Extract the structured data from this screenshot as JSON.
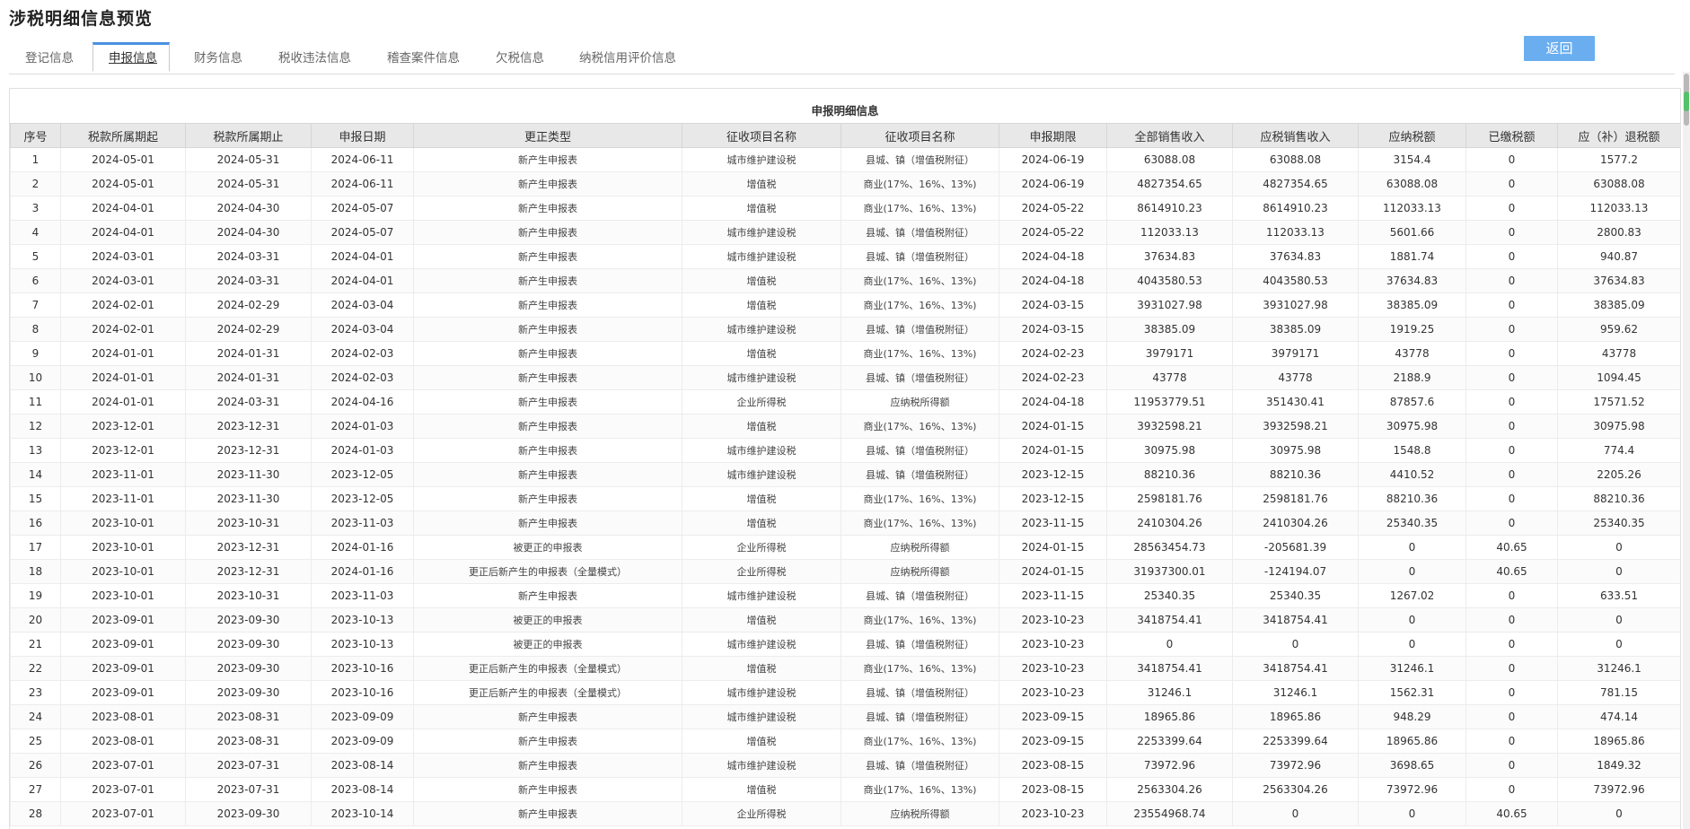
{
  "page_title": "涉税明细信息预览",
  "tabs": [
    {
      "label": "登记信息",
      "active": false
    },
    {
      "label": "申报信息",
      "active": true
    },
    {
      "label": "财务信息",
      "active": false
    },
    {
      "label": "税收违法信息",
      "active": false
    },
    {
      "label": "稽查案件信息",
      "active": false
    },
    {
      "label": "欠税信息",
      "active": false
    },
    {
      "label": "纳税信用评价信息",
      "active": false
    }
  ],
  "back_label": "返回",
  "table": {
    "caption": "申报明细信息",
    "columns": [
      "序号",
      "税款所属期起",
      "税款所属期止",
      "申报日期",
      "更正类型",
      "征收项目名称",
      "征收项目名称",
      "申报期限",
      "全部销售收入",
      "应税销售收入",
      "应纳税额",
      "已缴税额",
      "应（补）退税额"
    ],
    "rows": [
      [
        "1",
        "2024-05-01",
        "2024-05-31",
        "2024-06-11",
        "新产生申报表",
        "城市维护建设税",
        "县城、镇（增值税附征）",
        "2024-06-19",
        "63088.08",
        "63088.08",
        "3154.4",
        "0",
        "1577.2"
      ],
      [
        "2",
        "2024-05-01",
        "2024-05-31",
        "2024-06-11",
        "新产生申报表",
        "增值税",
        "商业(17%、16%、13%)",
        "2024-06-19",
        "4827354.65",
        "4827354.65",
        "63088.08",
        "0",
        "63088.08"
      ],
      [
        "3",
        "2024-04-01",
        "2024-04-30",
        "2024-05-07",
        "新产生申报表",
        "增值税",
        "商业(17%、16%、13%)",
        "2024-05-22",
        "8614910.23",
        "8614910.23",
        "112033.13",
        "0",
        "112033.13"
      ],
      [
        "4",
        "2024-04-01",
        "2024-04-30",
        "2024-05-07",
        "新产生申报表",
        "城市维护建设税",
        "县城、镇（增值税附征）",
        "2024-05-22",
        "112033.13",
        "112033.13",
        "5601.66",
        "0",
        "2800.83"
      ],
      [
        "5",
        "2024-03-01",
        "2024-03-31",
        "2024-04-01",
        "新产生申报表",
        "城市维护建设税",
        "县城、镇（增值税附征）",
        "2024-04-18",
        "37634.83",
        "37634.83",
        "1881.74",
        "0",
        "940.87"
      ],
      [
        "6",
        "2024-03-01",
        "2024-03-31",
        "2024-04-01",
        "新产生申报表",
        "增值税",
        "商业(17%、16%、13%)",
        "2024-04-18",
        "4043580.53",
        "4043580.53",
        "37634.83",
        "0",
        "37634.83"
      ],
      [
        "7",
        "2024-02-01",
        "2024-02-29",
        "2024-03-04",
        "新产生申报表",
        "增值税",
        "商业(17%、16%、13%)",
        "2024-03-15",
        "3931027.98",
        "3931027.98",
        "38385.09",
        "0",
        "38385.09"
      ],
      [
        "8",
        "2024-02-01",
        "2024-02-29",
        "2024-03-04",
        "新产生申报表",
        "城市维护建设税",
        "县城、镇（增值税附征）",
        "2024-03-15",
        "38385.09",
        "38385.09",
        "1919.25",
        "0",
        "959.62"
      ],
      [
        "9",
        "2024-01-01",
        "2024-01-31",
        "2024-02-03",
        "新产生申报表",
        "增值税",
        "商业(17%、16%、13%)",
        "2024-02-23",
        "3979171",
        "3979171",
        "43778",
        "0",
        "43778"
      ],
      [
        "10",
        "2024-01-01",
        "2024-01-31",
        "2024-02-03",
        "新产生申报表",
        "城市维护建设税",
        "县城、镇（增值税附征）",
        "2024-02-23",
        "43778",
        "43778",
        "2188.9",
        "0",
        "1094.45"
      ],
      [
        "11",
        "2024-01-01",
        "2024-03-31",
        "2024-04-16",
        "新产生申报表",
        "企业所得税",
        "应纳税所得额",
        "2024-04-18",
        "11953779.51",
        "351430.41",
        "87857.6",
        "0",
        "17571.52"
      ],
      [
        "12",
        "2023-12-01",
        "2023-12-31",
        "2024-01-03",
        "新产生申报表",
        "增值税",
        "商业(17%、16%、13%)",
        "2024-01-15",
        "3932598.21",
        "3932598.21",
        "30975.98",
        "0",
        "30975.98"
      ],
      [
        "13",
        "2023-12-01",
        "2023-12-31",
        "2024-01-03",
        "新产生申报表",
        "城市维护建设税",
        "县城、镇（增值税附征）",
        "2024-01-15",
        "30975.98",
        "30975.98",
        "1548.8",
        "0",
        "774.4"
      ],
      [
        "14",
        "2023-11-01",
        "2023-11-30",
        "2023-12-05",
        "新产生申报表",
        "城市维护建设税",
        "县城、镇（增值税附征）",
        "2023-12-15",
        "88210.36",
        "88210.36",
        "4410.52",
        "0",
        "2205.26"
      ],
      [
        "15",
        "2023-11-01",
        "2023-11-30",
        "2023-12-05",
        "新产生申报表",
        "增值税",
        "商业(17%、16%、13%)",
        "2023-12-15",
        "2598181.76",
        "2598181.76",
        "88210.36",
        "0",
        "88210.36"
      ],
      [
        "16",
        "2023-10-01",
        "2023-10-31",
        "2023-11-03",
        "新产生申报表",
        "增值税",
        "商业(17%、16%、13%)",
        "2023-11-15",
        "2410304.26",
        "2410304.26",
        "25340.35",
        "0",
        "25340.35"
      ],
      [
        "17",
        "2023-10-01",
        "2023-12-31",
        "2024-01-16",
        "被更正的申报表",
        "企业所得税",
        "应纳税所得额",
        "2024-01-15",
        "28563454.73",
        "-205681.39",
        "0",
        "40.65",
        "0"
      ],
      [
        "18",
        "2023-10-01",
        "2023-12-31",
        "2024-01-16",
        "更正后新产生的申报表（全量模式）",
        "企业所得税",
        "应纳税所得额",
        "2024-01-15",
        "31937300.01",
        "-124194.07",
        "0",
        "40.65",
        "0"
      ],
      [
        "19",
        "2023-10-01",
        "2023-10-31",
        "2023-11-03",
        "新产生申报表",
        "城市维护建设税",
        "县城、镇（增值税附征）",
        "2023-11-15",
        "25340.35",
        "25340.35",
        "1267.02",
        "0",
        "633.51"
      ],
      [
        "20",
        "2023-09-01",
        "2023-09-30",
        "2023-10-13",
        "被更正的申报表",
        "增值税",
        "商业(17%、16%、13%)",
        "2023-10-23",
        "3418754.41",
        "3418754.41",
        "0",
        "0",
        "0"
      ],
      [
        "21",
        "2023-09-01",
        "2023-09-30",
        "2023-10-13",
        "被更正的申报表",
        "城市维护建设税",
        "县城、镇（增值税附征）",
        "2023-10-23",
        "0",
        "0",
        "0",
        "0",
        "0"
      ],
      [
        "22",
        "2023-09-01",
        "2023-09-30",
        "2023-10-16",
        "更正后新产生的申报表（全量模式）",
        "增值税",
        "商业(17%、16%、13%)",
        "2023-10-23",
        "3418754.41",
        "3418754.41",
        "31246.1",
        "0",
        "31246.1"
      ],
      [
        "23",
        "2023-09-01",
        "2023-09-30",
        "2023-10-16",
        "更正后新产生的申报表（全量模式）",
        "城市维护建设税",
        "县城、镇（增值税附征）",
        "2023-10-23",
        "31246.1",
        "31246.1",
        "1562.31",
        "0",
        "781.15"
      ],
      [
        "24",
        "2023-08-01",
        "2023-08-31",
        "2023-09-09",
        "新产生申报表",
        "城市维护建设税",
        "县城、镇（增值税附征）",
        "2023-09-15",
        "18965.86",
        "18965.86",
        "948.29",
        "0",
        "474.14"
      ],
      [
        "25",
        "2023-08-01",
        "2023-08-31",
        "2023-09-09",
        "新产生申报表",
        "增值税",
        "商业(17%、16%、13%)",
        "2023-09-15",
        "2253399.64",
        "2253399.64",
        "18965.86",
        "0",
        "18965.86"
      ],
      [
        "26",
        "2023-07-01",
        "2023-07-31",
        "2023-08-14",
        "新产生申报表",
        "城市维护建设税",
        "县城、镇（增值税附征）",
        "2023-08-15",
        "73972.96",
        "73972.96",
        "3698.65",
        "0",
        "1849.32"
      ],
      [
        "27",
        "2023-07-01",
        "2023-07-31",
        "2023-08-14",
        "新产生申报表",
        "增值税",
        "商业(17%、16%、13%)",
        "2023-08-15",
        "2563304.26",
        "2563304.26",
        "73972.96",
        "0",
        "73972.96"
      ],
      [
        "28",
        "2023-07-01",
        "2023-09-30",
        "2023-10-14",
        "新产生申报表",
        "企业所得税",
        "应纳税所得额",
        "2023-10-23",
        "23554968.74",
        "0",
        "0",
        "40.65",
        "0"
      ]
    ]
  }
}
